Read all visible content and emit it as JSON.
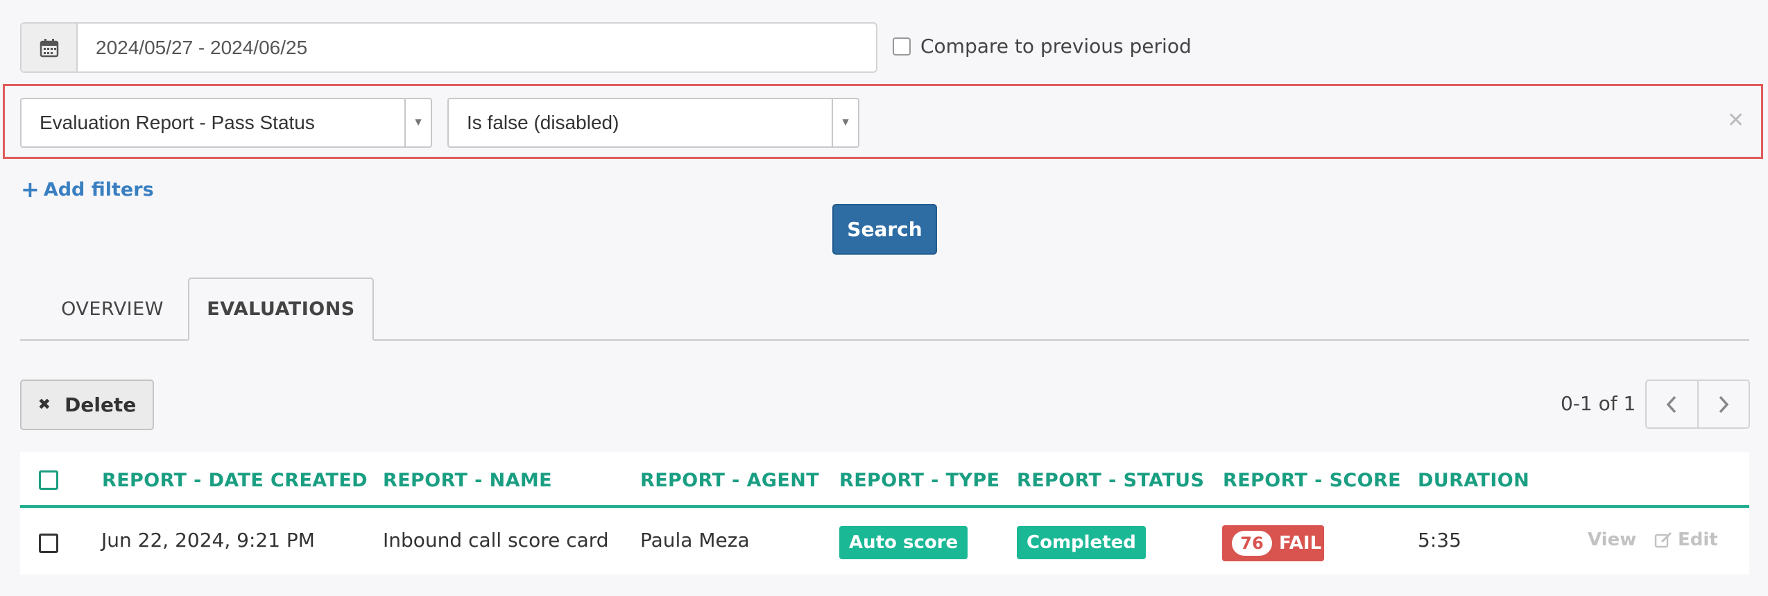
{
  "date_range": {
    "value": "2024/05/27 - 2024/06/25",
    "icon": "calendar-icon"
  },
  "compare": {
    "label": "Compare to previous period",
    "checked": false
  },
  "filter": {
    "field": "Evaluation Report - Pass Status",
    "operator": "Is false (disabled)",
    "remove_icon": "close-icon"
  },
  "add_filters": {
    "plus": "+",
    "label": "Add filters"
  },
  "search_button": "Search",
  "tabs": [
    {
      "label": "OVERVIEW",
      "active": false
    },
    {
      "label": "EVALUATIONS",
      "active": true
    }
  ],
  "toolbar": {
    "delete_icon": "✖",
    "delete_label": "Delete",
    "pagination": "0-1 of 1"
  },
  "table": {
    "columns": [
      "REPORT - DATE CREATED",
      "REPORT - NAME",
      "REPORT - AGENT",
      "REPORT - TYPE",
      "REPORT - STATUS",
      "REPORT - SCORE",
      "DURATION"
    ],
    "rows": [
      {
        "date_created": "Jun 22, 2024, 9:21 PM",
        "name": "Inbound call score card",
        "agent": "Paula Meza",
        "type": "Auto score",
        "status": "Completed",
        "score": "76",
        "score_result": "FAIL",
        "duration": "5:35",
        "view_label": "View",
        "edit_label": "Edit"
      }
    ]
  },
  "colors": {
    "accent_green": "#1a9e82",
    "primary_blue": "#2e6da4",
    "fail_red": "#d9534f",
    "highlight_border": "#e05a5a"
  }
}
